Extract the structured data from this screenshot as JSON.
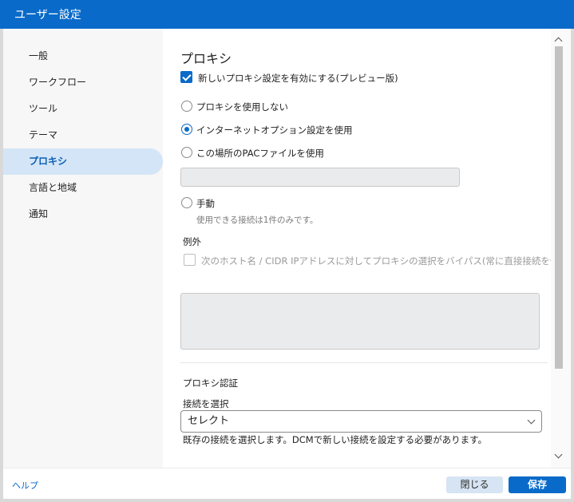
{
  "window": {
    "title": "ユーザー設定"
  },
  "sidebar": {
    "items": [
      {
        "label": "一般",
        "active": false
      },
      {
        "label": "ワークフロー",
        "active": false
      },
      {
        "label": "ツール",
        "active": false
      },
      {
        "label": "テーマ",
        "active": false
      },
      {
        "label": "プロキシ",
        "active": true
      },
      {
        "label": "言語と地域",
        "active": false
      },
      {
        "label": "通知",
        "active": false
      }
    ]
  },
  "proxy": {
    "title": "プロキシ",
    "enable_new_settings": {
      "label": "新しいプロキシ設定を有効にする(プレビュー版)",
      "checked": true
    },
    "options": {
      "none": {
        "label": "プロキシを使用しない",
        "selected": false
      },
      "internet_options": {
        "label": "インターネットオプション設定を使用",
        "selected": true
      },
      "pac_file": {
        "label": "この場所のPACファイルを使用",
        "selected": false,
        "value": ""
      },
      "manual": {
        "label": "手動",
        "selected": false,
        "hint": "使用できる接続は1件のみです。"
      }
    },
    "exceptions": {
      "title": "例外",
      "bypass_label": "次のホスト名 / CIDR IPアドレスに対してプロキシの選択をバイパス(常に直接接続を使用):",
      "bypass_checked": false,
      "value": ""
    },
    "auth": {
      "title": "プロキシ認証",
      "connection_label": "接続を選択",
      "select_value": "セレクト",
      "help_text": "既存の接続を選択します。DCMで新しい接続を設定する必要があります。"
    }
  },
  "footer": {
    "help_label": "ヘルプ",
    "close_label": "閉じる",
    "save_label": "保存"
  },
  "colors": {
    "accent": "#0a6ac9",
    "active_nav_bg": "#d4e5f7",
    "disabled_input_bg": "#eaebed"
  }
}
